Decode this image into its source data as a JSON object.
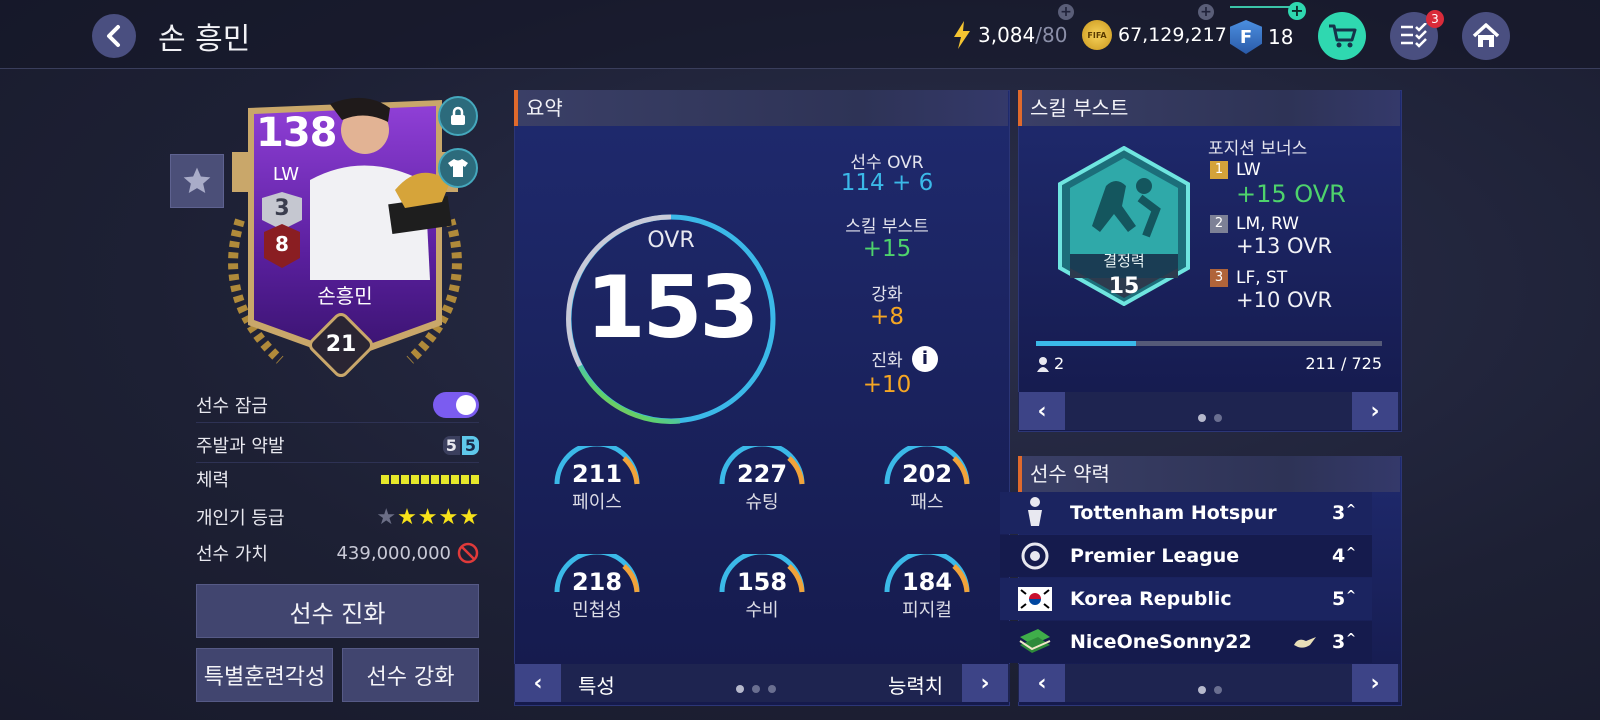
{
  "header": {
    "title": "손 흥민",
    "energy": "3,084",
    "energy_max": "/80",
    "coins": "67,129,217",
    "fc_points": "18",
    "fifa_coin_label": "FIFA",
    "fc_letter": "F",
    "notification_count": "3"
  },
  "card": {
    "ovr": "138",
    "position": "LW",
    "grade": "3",
    "enhance": "8",
    "name": "손흥민",
    "season_num": "21"
  },
  "info": {
    "lock_label": "선수 잠금",
    "lock_on": true,
    "foot_label": "주발과 약발",
    "foot_left": "5",
    "foot_right": "5",
    "stamina_label": "체력",
    "stamina_level": 10,
    "popularity_label": "개인기 등급",
    "popularity_stars": 4,
    "popularity_max": 5,
    "value_label": "선수 가치",
    "value": "439,000,000"
  },
  "buttons": {
    "evolve": "선수 진화",
    "special_training": "특별훈련각성",
    "enhance": "선수 강화"
  },
  "summary": {
    "title": "요약",
    "ovr_label": "OVR",
    "ovr": "153",
    "player_ovr_label": "선수 OVR",
    "player_ovr": "114 + 6",
    "skill_boost_label": "스킬 부스트",
    "skill_boost": "+15",
    "enhance_label": "강화",
    "enhance": "+8",
    "evolution_label": "진화",
    "evolution": "+10",
    "stats": [
      {
        "value": "211",
        "label": "페이스"
      },
      {
        "value": "227",
        "label": "슈팅"
      },
      {
        "value": "202",
        "label": "패스"
      },
      {
        "value": "218",
        "label": "민첩성"
      },
      {
        "value": "158",
        "label": "수비"
      },
      {
        "value": "184",
        "label": "피지컬"
      }
    ],
    "nav_left_label": "특성",
    "nav_right_label": "능력치"
  },
  "skill_boost": {
    "title": "스킬 부스트",
    "badge_name": "결정력",
    "badge_level": "15",
    "position_bonus_label": "포지션 보너스",
    "bonuses": [
      {
        "rank": "1",
        "pos": "LW",
        "value": "+15 OVR"
      },
      {
        "rank": "2",
        "pos": "LM, RW",
        "value": "+13 OVR"
      },
      {
        "rank": "3",
        "pos": "LF, ST",
        "value": "+10 OVR"
      }
    ],
    "count": "2",
    "progress_text": "211 / 725",
    "progress_fraction": 0.29
  },
  "chemistry": {
    "title": "선수 약력",
    "rows": [
      {
        "name": "Tottenham Hotspur",
        "value": "3"
      },
      {
        "name": "Premier League",
        "value": "4"
      },
      {
        "name": "Korea Republic",
        "value": "5"
      },
      {
        "name": "NiceOneSonny22",
        "value": "3"
      }
    ]
  },
  "colors": {
    "accent_teal": "#2fd8b0",
    "ovr_blue": "#3bb9e8",
    "green": "#4ed36c",
    "orange": "#f5a623",
    "toggle": "#7b5cf0"
  }
}
